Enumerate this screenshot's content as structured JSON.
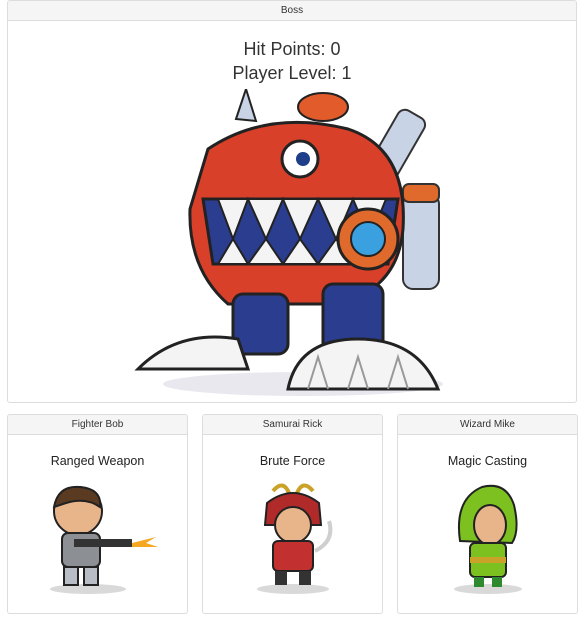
{
  "boss": {
    "heading": "Boss",
    "hit_points_label": "Hit Points: 0",
    "player_level_label": "Player Level: 1",
    "image_icon": "mecha-dinosaur-boss"
  },
  "heroes": [
    {
      "name": "Fighter Bob",
      "skill": "Ranged Weapon",
      "image_icon": "soldier-with-rifle"
    },
    {
      "name": "Samurai Rick",
      "skill": "Brute Force",
      "image_icon": "samurai-with-sword"
    },
    {
      "name": "Wizard Mike",
      "skill": "Magic Casting",
      "image_icon": "hooded-green-wizard"
    }
  ]
}
